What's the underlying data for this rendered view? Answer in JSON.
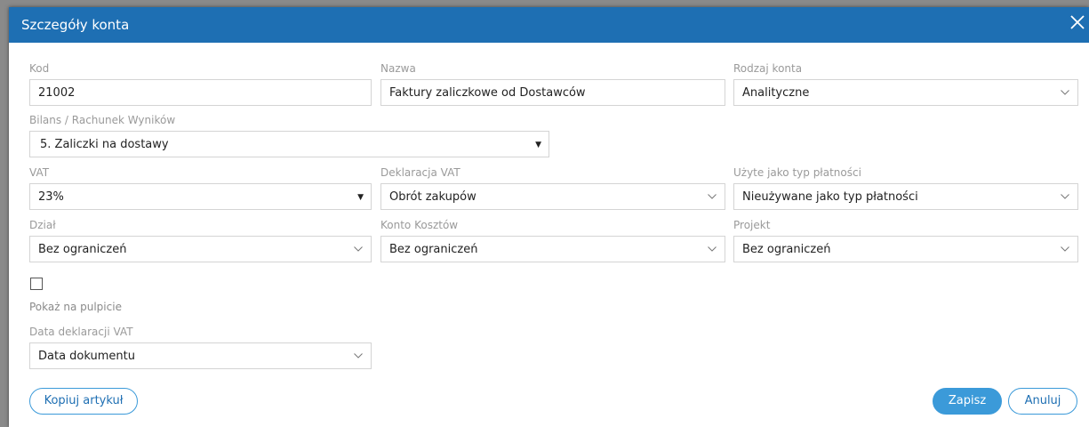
{
  "dialog": {
    "title": "Szczegóły konta",
    "close_icon": "close-icon"
  },
  "fields": {
    "kod": {
      "label": "Kod",
      "value": "21002"
    },
    "nazwa": {
      "label": "Nazwa",
      "value": "Faktury zaliczkowe od Dostawców"
    },
    "rodzaj_konta": {
      "label": "Rodzaj konta",
      "value": "Analityczne"
    },
    "bilans": {
      "label": "Bilans / Rachunek Wyników",
      "value": "5. Zaliczki na dostawy"
    },
    "vat": {
      "label": "VAT",
      "value": "23%"
    },
    "deklaracja_vat": {
      "label": "Deklaracja VAT",
      "value": "Obrót zakupów"
    },
    "typ_platnosci": {
      "label": "Użyte jako typ płatności",
      "value": "Nieużywane jako typ płatności"
    },
    "dzial": {
      "label": "Dział",
      "value": "Bez ograniczeń"
    },
    "konto_kosztow": {
      "label": "Konto Kosztów",
      "value": "Bez ograniczeń"
    },
    "projekt": {
      "label": "Projekt",
      "value": "Bez ograniczeń"
    },
    "data_deklaracji": {
      "label": "Data deklaracji VAT",
      "value": "Data dokumentu"
    }
  },
  "checkbox": {
    "label": "Pokaż na pulpicie",
    "checked": false
  },
  "buttons": {
    "copy": "Kopiuj artykuł",
    "save": "Zapisz",
    "cancel": "Anuluj"
  },
  "colors": {
    "titlebar": "#1e6fb3",
    "accent": "#3b9ad9"
  }
}
